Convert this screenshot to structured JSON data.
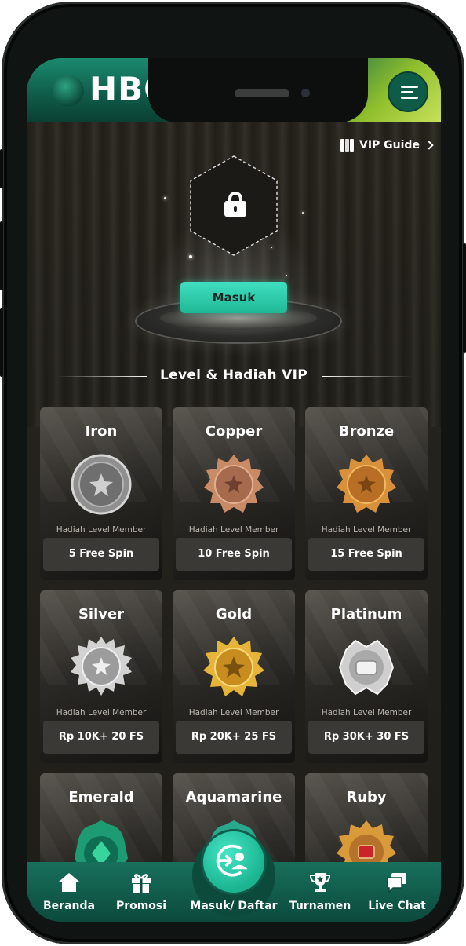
{
  "header": {
    "logo_text": "HBO9",
    "menu_icon": "menu-icon",
    "colors": {
      "header_green": "#0f5a48",
      "accent_lime": "#c9e05a",
      "cta_teal": "#1fb896"
    }
  },
  "vip_guide": {
    "label": "VIP Guide",
    "icon": "book-icon"
  },
  "hero": {
    "login_button_label": "Masuk",
    "locked_icon": "lock-icon"
  },
  "section": {
    "title": "Level & Hadiah VIP"
  },
  "levels": [
    {
      "name": "Iron",
      "subtitle": "Hadiah Level Member",
      "reward": "5 Free Spin"
    },
    {
      "name": "Copper",
      "subtitle": "Hadiah Level Member",
      "reward": "10 Free Spin"
    },
    {
      "name": "Bronze",
      "subtitle": "Hadiah Level Member",
      "reward": "15 Free Spin"
    },
    {
      "name": "Silver",
      "subtitle": "Hadiah Level Member",
      "reward": "Rp 10K+ 20 FS"
    },
    {
      "name": "Gold",
      "subtitle": "Hadiah Level Member",
      "reward": "Rp 20K+ 25 FS"
    },
    {
      "name": "Platinum",
      "subtitle": "Hadiah Level Member",
      "reward": "Rp 30K+ 30 FS"
    },
    {
      "name": "Emerald"
    },
    {
      "name": "Aquamarine"
    },
    {
      "name": "Ruby"
    }
  ],
  "bottom_nav": {
    "items": [
      {
        "label": "Beranda",
        "icon": "home-icon"
      },
      {
        "label": "Promosi",
        "icon": "gift-icon"
      },
      {
        "label": "Masuk/ Daftar",
        "icon": "login-icon"
      },
      {
        "label": "Turnamen",
        "icon": "trophy-icon"
      },
      {
        "label": "Live Chat",
        "icon": "chat-icon"
      }
    ]
  }
}
